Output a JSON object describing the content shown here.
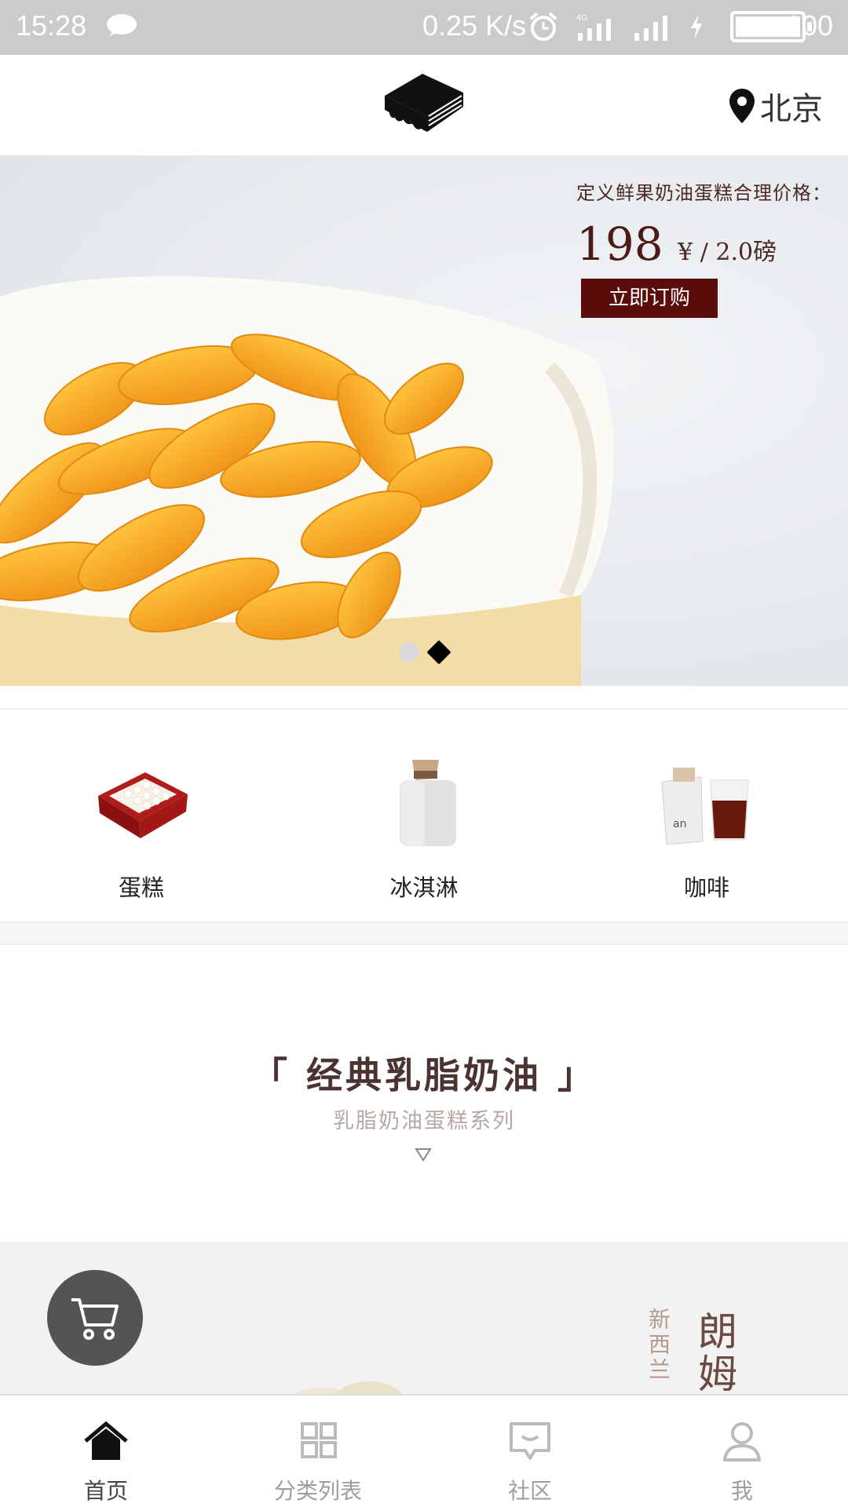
{
  "status_bar": {
    "time": "15:28",
    "network_speed": "0.25 K/s",
    "battery": "100",
    "network_type": "4G"
  },
  "header": {
    "location": "北京",
    "logo_icon": "cake-logo-icon"
  },
  "banner": {
    "headline": "定义鲜果奶油蛋糕合理价格：",
    "price": "198",
    "price_unit": "¥ / 2.0磅",
    "buy_label": "立即订购",
    "slide_count": 2,
    "active_slide": 2
  },
  "categories": [
    {
      "label": "蛋糕",
      "icon": "cake-icon"
    },
    {
      "label": "冰淇淋",
      "icon": "ice-cream-icon"
    },
    {
      "label": "咖啡",
      "icon": "coffee-icon"
    }
  ],
  "section": {
    "title": "「 经典乳脂奶油 」",
    "subtitle": "乳脂奶油蛋糕系列",
    "arrow": "▽"
  },
  "preview": {
    "vertical_small": "新西兰",
    "vertical_large": "朗姆"
  },
  "tabs": [
    {
      "label": "首页",
      "icon": "home-icon",
      "active": true
    },
    {
      "label": "分类列表",
      "icon": "grid-icon",
      "active": false
    },
    {
      "label": "社区",
      "icon": "chat-icon",
      "active": false
    },
    {
      "label": "我",
      "icon": "user-icon",
      "active": false
    }
  ],
  "colors": {
    "accent": "#5a0d0a",
    "title_text": "#4a3330",
    "tab_inactive": "#9e9e9e",
    "status_bar": "#cbcbcb"
  }
}
